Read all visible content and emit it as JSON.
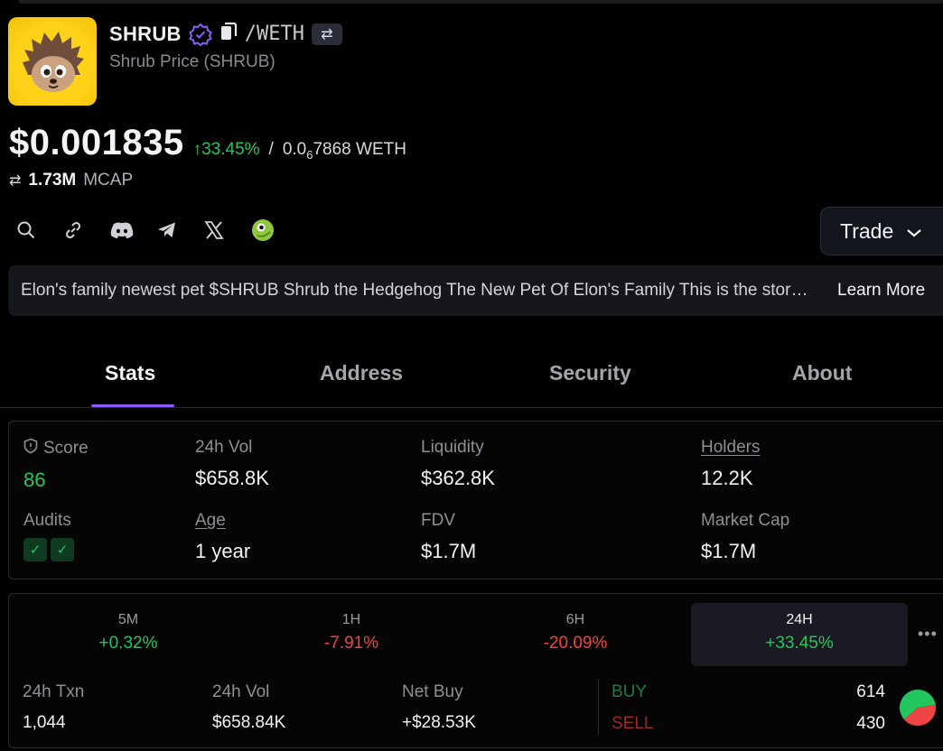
{
  "token": {
    "symbol": "SHRUB",
    "pair_quote": "/WETH",
    "swap_glyph": "⇄",
    "full_name": "Shrub Price (SHRUB)",
    "logo_icon": "hedgehog-logo"
  },
  "price": {
    "usd": "$0.001835",
    "change": "↑33.45%",
    "separator": "/",
    "weth_prefix": "0.0",
    "weth_zeros": "6",
    "weth_suffix": "7868 WETH",
    "change_color": "#22c55e"
  },
  "mcap": {
    "icon": "⇄",
    "value": "1.73M",
    "label": "MCAP"
  },
  "links": [
    "search-icon",
    "link-icon",
    "discord-icon",
    "telegram-icon",
    "x-icon",
    "coingecko-icon"
  ],
  "trade_button": {
    "label": "Trade"
  },
  "description": {
    "text": "Elon's family newest pet $SHRUB Shrub the Hedgehog The New Pet Of Elon's Family This is the story of Shrub",
    "learn_more": "Learn More"
  },
  "tabs": [
    {
      "label": "Stats",
      "active": true
    },
    {
      "label": "Address",
      "active": false
    },
    {
      "label": "Security",
      "active": false
    },
    {
      "label": "About",
      "active": false
    }
  ],
  "accent_color": "#8b5cf6",
  "stats": {
    "score_label": "Score",
    "score_value": "86",
    "vol_label": "24h Vol",
    "vol_value": "$658.8K",
    "liq_label": "Liquidity",
    "liq_value": "$362.8K",
    "holders_label": "Holders",
    "holders_value": "12.2K",
    "audits_label": "Audits",
    "audit_check": "✓",
    "age_label": "Age",
    "age_value": "1 year",
    "fdv_label": "FDV",
    "fdv_value": "$1.7M",
    "mcap_label": "Market Cap",
    "mcap_value": "$1.7M"
  },
  "timeframes": [
    {
      "label": "5M",
      "value": "+0.32%",
      "dir": "pos"
    },
    {
      "label": "1H",
      "value": "-7.91%",
      "dir": "neg"
    },
    {
      "label": "6H",
      "value": "-20.09%",
      "dir": "neg"
    },
    {
      "label": "24H",
      "value": "+33.45%",
      "dir": "pos",
      "active": true
    }
  ],
  "more_glyph": "•••",
  "txns": {
    "txn_label": "24h Txn",
    "txn_value": "1,044",
    "vol_label": "24h Vol",
    "vol_value": "$658.84K",
    "net_label": "Net Buy",
    "net_value": "+$28.53K",
    "buy_label": "BUY",
    "buy_count": "614",
    "sell_label": "SELL",
    "sell_count": "430",
    "buy_color": "#22c55e",
    "sell_color": "#ef4444"
  }
}
